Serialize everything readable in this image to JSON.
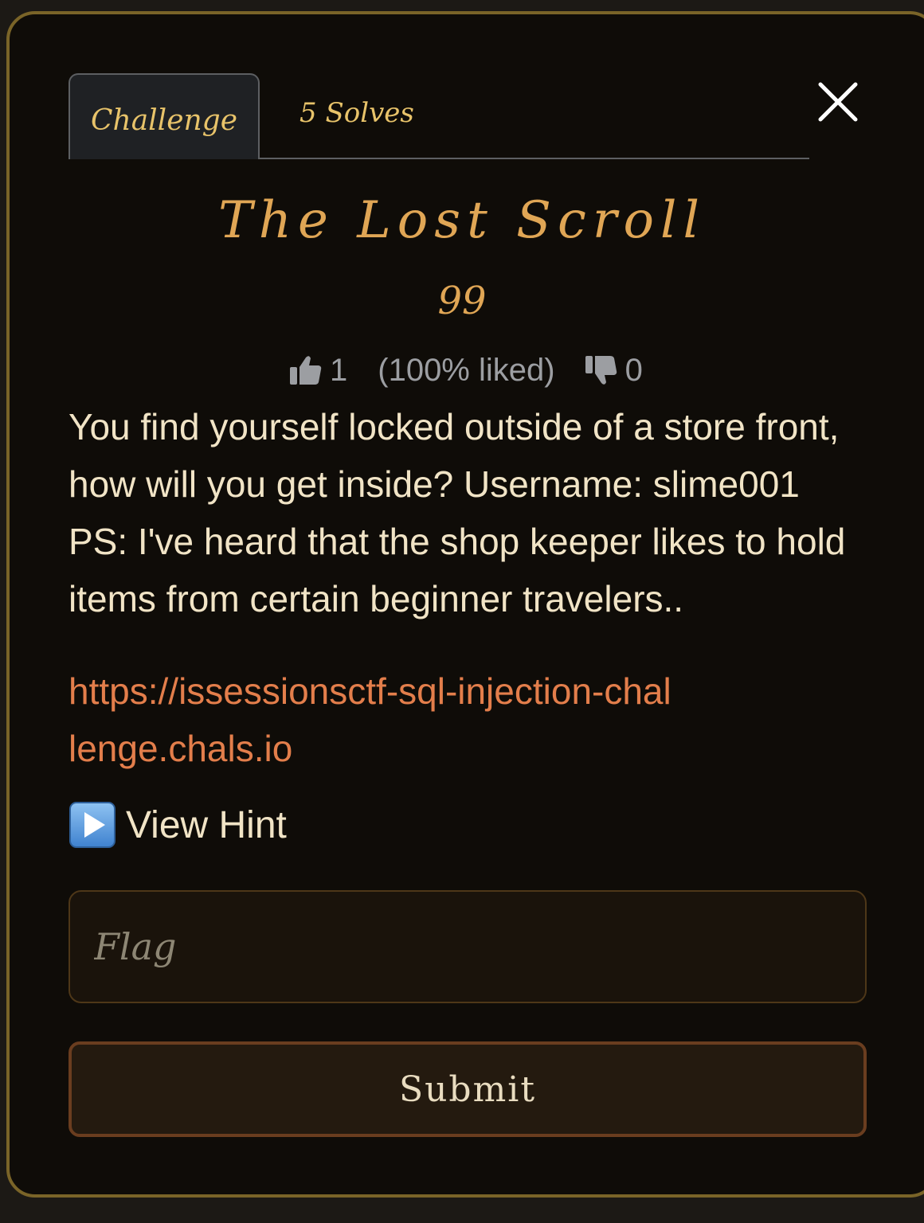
{
  "tabs": {
    "challenge": "Challenge",
    "solves": "5 Solves"
  },
  "challenge": {
    "title": "The Lost Scroll",
    "points": "99",
    "likes": "1",
    "liked_percent": "(100% liked)",
    "dislikes": "0",
    "description": "You find yourself locked outside of a store front, how will you get inside? Username: slime001 PS: I've heard that the shop keeper likes to hold items from certain beginner travelers..",
    "link": "https://issessionsctf-sql-injection-challenge.chals.io",
    "hint_label": "View Hint"
  },
  "form": {
    "flag_placeholder": "Flag",
    "submit_label": "Submit"
  },
  "icons": {
    "close": "close-icon",
    "thumbs_up": "thumbs-up-icon",
    "thumbs_down": "thumbs-down-icon",
    "hint": "play-icon"
  },
  "colors": {
    "accent_gold": "#e0a655",
    "tab_text": "#e8c36a",
    "link": "#e37e4b",
    "body_text": "#f1e4c6",
    "modal_border": "#7a6428",
    "background": "#0f0c08"
  }
}
